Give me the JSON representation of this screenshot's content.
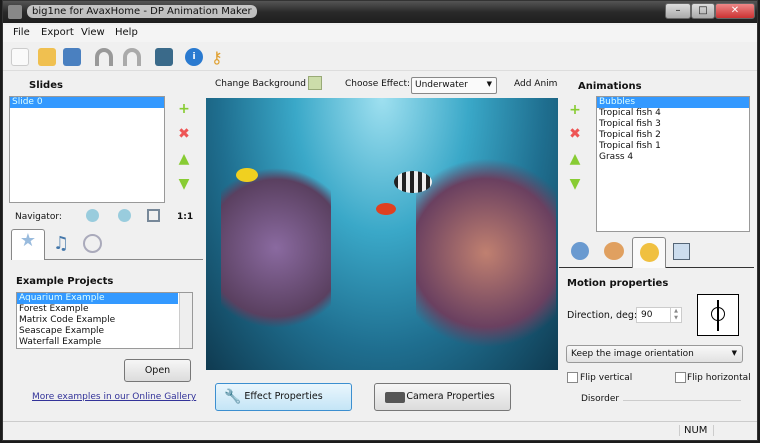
{
  "window": {
    "title": "big1ne for AvaxHome - DP Animation Maker",
    "minimize": "–",
    "maximize": "□",
    "close": "✕"
  },
  "menu": [
    "File",
    "Export",
    "View",
    "Help"
  ],
  "slides": {
    "label": "Slides",
    "items": [
      "Slide 0"
    ]
  },
  "navigator": {
    "label": "Navigator:",
    "actual_size": "1:1"
  },
  "examples": {
    "label": "Example Projects",
    "items": [
      "Aquarium Example",
      "Forest Example",
      "Matrix Code Example",
      "Seascape Example",
      "Waterfall Example"
    ],
    "open": "Open",
    "link": "More examples in our Online Gallery"
  },
  "center": {
    "change_background": "Change Background",
    "choose_effect": "Choose Effect:",
    "effect_value": "Underwater",
    "add_animation": "Add Anima",
    "effect_properties": "Effect Properties",
    "camera_properties": "Camera Properties"
  },
  "animations": {
    "label": "Animations",
    "items": [
      "Bubbles",
      "Tropical fish 4",
      "Tropical fish 3",
      "Tropical fish 2",
      "Tropical fish 1",
      "Grass 4"
    ]
  },
  "motion": {
    "label": "Motion properties",
    "direction_label": "Direction, deg:",
    "direction_value": "90",
    "orientation": "Keep the image orientation",
    "flip_vertical": "Flip vertical",
    "flip_horizontal": "Flip horizontal",
    "disorder": "Disorder"
  },
  "status": {
    "num": "NUM"
  }
}
